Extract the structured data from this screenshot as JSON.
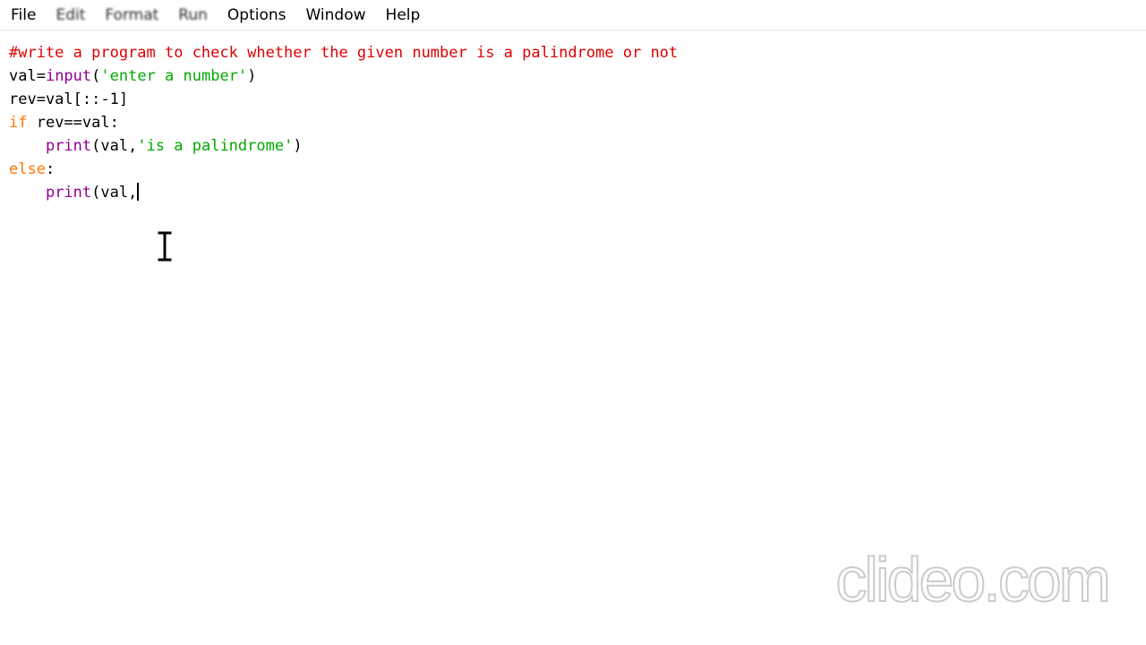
{
  "menubar": {
    "items": [
      "File",
      "Edit",
      "Format",
      "Run",
      "Options",
      "Window",
      "Help"
    ]
  },
  "editor": {
    "line1": {
      "comment": "#write a program to check whether the given number is a palindrome or not"
    },
    "line2": {
      "var": "val=",
      "builtin": "input",
      "open": "(",
      "string": "'enter a number'",
      "close": ")"
    },
    "line3": {
      "text": "rev=val[::-1]"
    },
    "line4": {
      "keyword": "if",
      "rest": " rev==val:"
    },
    "line5": {
      "indent": "    ",
      "builtin": "print",
      "args": "(val,",
      "string": "'is a palindrome'",
      "close": ")"
    },
    "line6": {
      "keyword": "else",
      "rest": ":"
    },
    "line7": {
      "indent": "    ",
      "builtin": "print",
      "args": "(val,"
    }
  },
  "cursor_icon": "ibeam-cursor-icon",
  "watermark": {
    "text": "clideo.com"
  },
  "colors": {
    "comment": "#dd0000",
    "builtin": "#900090",
    "string": "#00aa00",
    "keyword": "#ff7700",
    "text": "#000000",
    "background": "#ffffff"
  }
}
